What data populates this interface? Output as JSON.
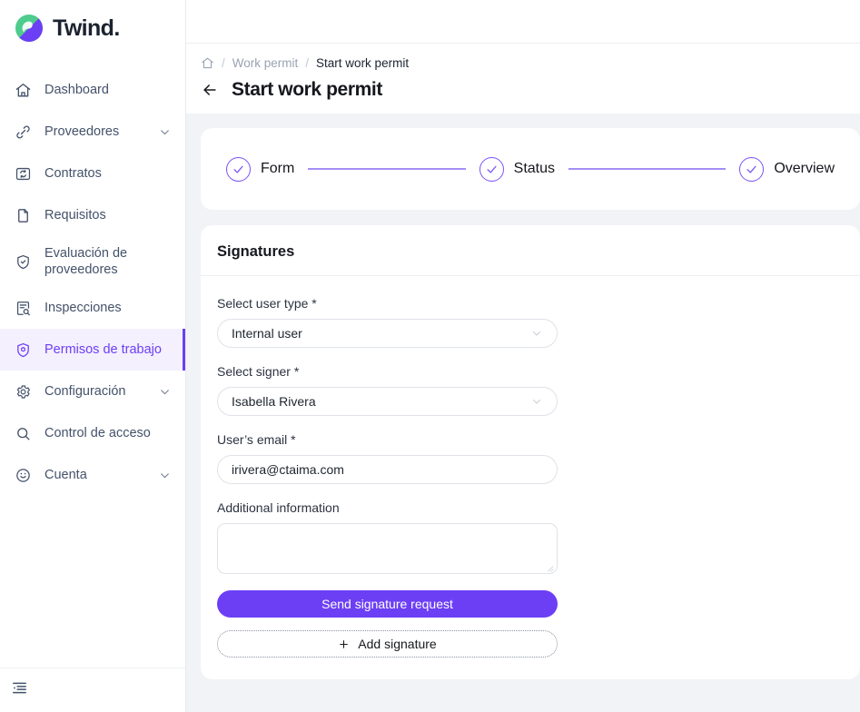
{
  "brand": {
    "name": "Twind.",
    "logo_icon": "twind-swirl-logo",
    "logo_green": "#4ecb8d",
    "logo_purple": "#6c3ff5",
    "accent": "#6c3ff5",
    "active_bg": "#f4f0fe"
  },
  "sidebar": {
    "items": [
      {
        "label": "Dashboard",
        "icon": "home-icon",
        "expandable": false,
        "active": false
      },
      {
        "label": "Proveedores",
        "icon": "link-icon",
        "expandable": true,
        "active": false
      },
      {
        "label": "Contratos",
        "icon": "contract-refresh-icon",
        "expandable": false,
        "active": false
      },
      {
        "label": "Requisitos",
        "icon": "file-icon",
        "expandable": false,
        "active": false
      },
      {
        "label": "Evaluación de proveedores",
        "icon": "shield-check-icon",
        "expandable": false,
        "active": false
      },
      {
        "label": "Inspecciones",
        "icon": "clipboard-search-icon",
        "expandable": false,
        "active": false
      },
      {
        "label": "Permisos de trabajo",
        "icon": "shield-permit-icon",
        "expandable": false,
        "active": true
      },
      {
        "label": "Configuración",
        "icon": "gear-icon",
        "expandable": true,
        "active": false
      },
      {
        "label": "Control de acceso",
        "icon": "search-icon",
        "expandable": false,
        "active": false
      },
      {
        "label": "Cuenta",
        "icon": "smiley-icon",
        "expandable": true,
        "active": false
      }
    ],
    "footer": {
      "collapse_icon": "sidebar-collapse-icon"
    }
  },
  "header": {
    "breadcrumb": {
      "home_icon": "home-icon",
      "separator": "/",
      "items": [
        {
          "label": "Work permit",
          "current": false
        },
        {
          "label": "Start work permit",
          "current": true
        }
      ]
    },
    "back_icon": "arrow-left-icon",
    "title": "Start work permit"
  },
  "stepper": {
    "steps": [
      {
        "label": "Form",
        "state": "complete",
        "icon": "check-icon"
      },
      {
        "label": "Status",
        "state": "complete",
        "icon": "check-icon"
      },
      {
        "label": "Overview",
        "state": "complete",
        "icon": "check-icon"
      }
    ]
  },
  "signatures": {
    "title": "Signatures",
    "fields": {
      "user_type": {
        "label": "Select user type *",
        "value": "Internal user",
        "placeholder": "Select user type",
        "chevron_icon": "chevron-down-icon"
      },
      "signer": {
        "label": "Select signer *",
        "value": "Isabella Rivera",
        "placeholder": "Select signer",
        "chevron_icon": "chevron-down-icon"
      },
      "email": {
        "label": "User’s email *",
        "value": "irivera@ctaima.com",
        "placeholder": "User’s email"
      },
      "additional": {
        "label": "Additional information",
        "value": "",
        "placeholder": "",
        "resize_icon": "resize-grip-icon"
      }
    },
    "actions": {
      "send": {
        "label": "Send signature request"
      },
      "add": {
        "label": "Add signature",
        "icon": "plus-icon"
      }
    }
  }
}
